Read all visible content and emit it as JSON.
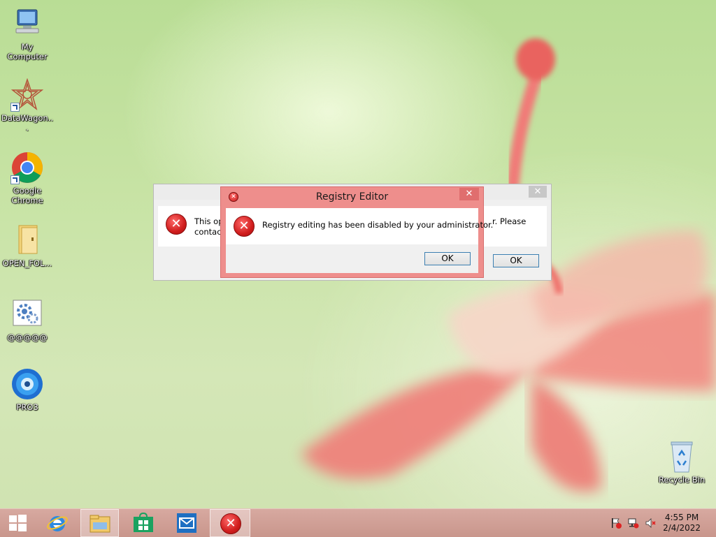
{
  "desktop": {
    "icons": [
      {
        "label": "My Computer"
      },
      {
        "label": "DataWagon..."
      },
      {
        "label": "Google Chrome"
      },
      {
        "label": "OPEN_FOL..."
      },
      {
        "label": "@@@@@"
      },
      {
        "label": "PRO3"
      },
      {
        "label": "Recycle Bin"
      }
    ]
  },
  "back_dialog": {
    "message_left": "This op",
    "message_left_2": "contact",
    "message_right": "r. Please",
    "ok_label": "OK",
    "close_glyph": "✕"
  },
  "front_dialog": {
    "title": "Registry Editor",
    "message": "Registry editing has been disabled by your administrator.",
    "ok_label": "OK",
    "close_glyph": "✕"
  },
  "taskbar": {
    "time": "4:55 PM",
    "date": "2/4/2022"
  },
  "colors": {
    "error_red": "#d01d1d",
    "dialog_title_active": "#ee8e8c",
    "taskbar": "#c9968c"
  }
}
